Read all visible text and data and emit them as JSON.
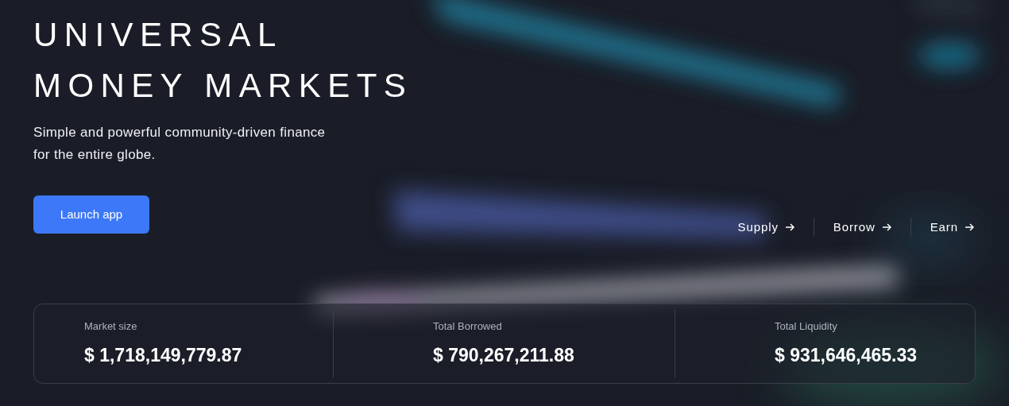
{
  "hero": {
    "title_lines": [
      "UNIVERSAL",
      "MONEY MARKETS"
    ],
    "subtitle_lines": [
      "Simple and powerful community-driven finance",
      "for the entire globe."
    ],
    "button": "Launch app"
  },
  "links": [
    {
      "label": "Supply"
    },
    {
      "label": "Borrow"
    },
    {
      "label": "Earn"
    }
  ],
  "stats": [
    {
      "label": "Market size",
      "value": "$ 1,718,149,779.87"
    },
    {
      "label": "Total Borrowed",
      "value": "$ 790,267,211.88"
    },
    {
      "label": "Total Liquidity",
      "value": "$ 931,646,465.33"
    }
  ]
}
